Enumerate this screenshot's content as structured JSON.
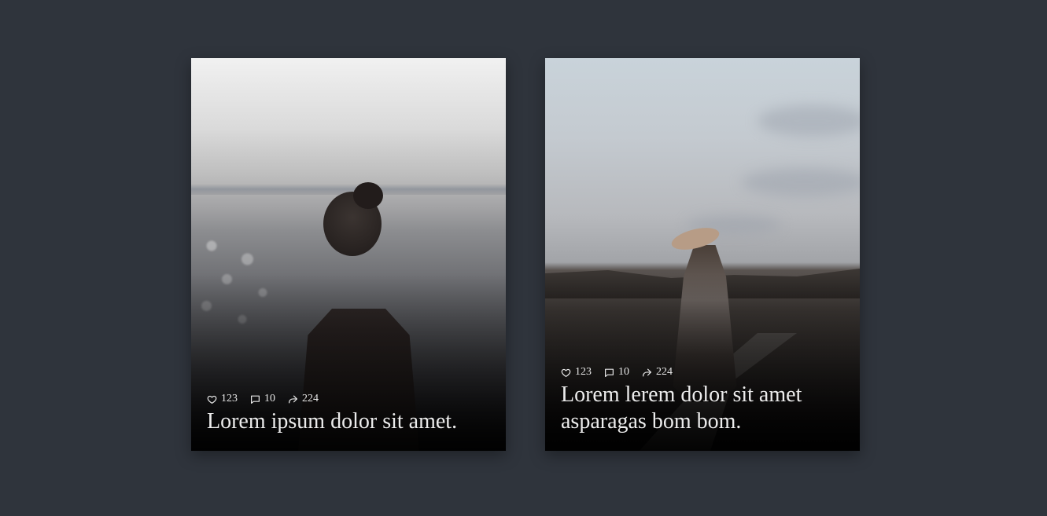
{
  "cards": [
    {
      "likes": "123",
      "comments": "10",
      "shares": "224",
      "title": "Lorem ipsum dolor sit amet."
    },
    {
      "likes": "123",
      "comments": "10",
      "shares": "224",
      "title": "Lorem lerem dolor sit amet asparagas bom bom."
    }
  ],
  "icons": {
    "like": "heart-icon",
    "comment": "comment-icon",
    "share": "share-icon"
  },
  "colors": {
    "background": "#2f343c",
    "text": "#e8e8e8"
  }
}
